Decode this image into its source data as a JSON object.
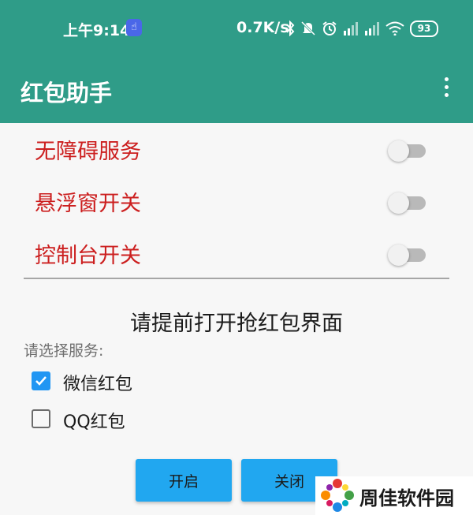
{
  "status_bar": {
    "time": "上午9:14",
    "net_speed": "0.7K/s",
    "battery": "93",
    "icons": [
      "hand-touch-icon",
      "bluetooth-icon",
      "mute-icon",
      "alarm-icon",
      "signal-icon",
      "signal-icon",
      "wifi-icon",
      "battery-icon"
    ]
  },
  "app_bar": {
    "title": "红包助手",
    "menu_icon": "more-vert-icon",
    "color": "#2f9c88"
  },
  "toggles": [
    {
      "label": "无障碍服务",
      "on": false
    },
    {
      "label": "悬浮窗开关",
      "on": false
    },
    {
      "label": "控制台开关",
      "on": false
    }
  ],
  "instruction": "请提前打开抢红包界面",
  "service_section": {
    "label": "请选择服务:",
    "options": [
      {
        "label": "微信红包",
        "checked": true
      },
      {
        "label": "QQ红包",
        "checked": false
      }
    ]
  },
  "buttons": {
    "start": "开启",
    "close": "关闭"
  },
  "watermark": {
    "text": "周佳软件园"
  },
  "colors": {
    "toggle_label": "#cc1f1f",
    "button": "#21a7f0",
    "checkbox_checked": "#2196f3"
  }
}
